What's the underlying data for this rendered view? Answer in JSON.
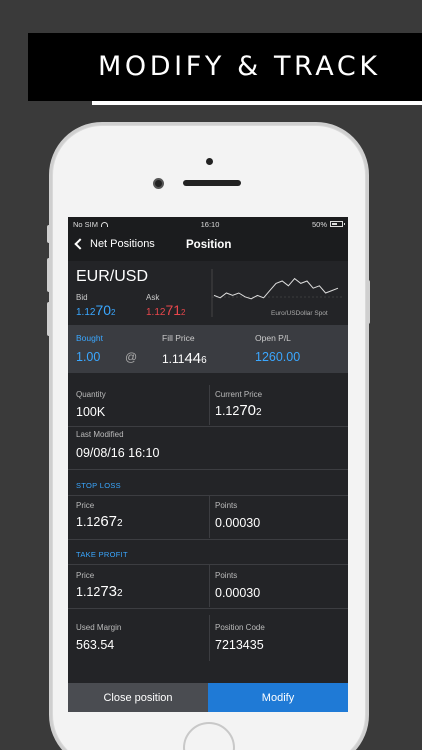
{
  "promo": {
    "headline": "MODIFY & TRACK"
  },
  "status": {
    "carrier": "No SIM",
    "time": "16:10",
    "battery": "50%"
  },
  "nav": {
    "back_label": "Net Positions",
    "title": "Position"
  },
  "instrument": {
    "symbol": "EUR/USD",
    "bid_label": "Bid",
    "ask_label": "Ask",
    "bid": {
      "pre": "1.12",
      "big": "70",
      "post": "2"
    },
    "ask": {
      "pre": "1.12",
      "big": "71",
      "post": "2"
    },
    "chart_caption": "Euro/USDollar Spot"
  },
  "fill": {
    "bought_label": "Bought",
    "bought_value": "1.00",
    "at": "@",
    "fill_price_label": "Fill Price",
    "fill_price": {
      "pre": "1.11",
      "big": "44",
      "post": "6"
    },
    "pl_label": "Open P/L",
    "pl_value": "1260.00"
  },
  "details": {
    "quantity_label": "Quantity",
    "quantity_value": "100K",
    "current_price_label": "Current Price",
    "current_price": {
      "pre": "1.12",
      "big": "70",
      "post": "2"
    },
    "last_modified_label": "Last Modified",
    "last_modified_value": "09/08/16 16:10"
  },
  "stop_loss": {
    "heading": "STOP LOSS",
    "price_label": "Price",
    "price": {
      "pre": "1.12",
      "big": "67",
      "post": "2"
    },
    "points_label": "Points",
    "points_value": "0.00030"
  },
  "take_profit": {
    "heading": "TAKE PROFIT",
    "price_label": "Price",
    "price": {
      "pre": "1.12",
      "big": "73",
      "post": "2"
    },
    "points_label": "Points",
    "points_value": "0.00030"
  },
  "margin": {
    "used_margin_label": "Used Margin",
    "used_margin_value": "563.54",
    "position_code_label": "Position Code",
    "position_code_value": "7213435"
  },
  "buttons": {
    "close_label": "Close position",
    "modify_label": "Modify"
  },
  "colors": {
    "accent": "#3aa7ff",
    "ask_red": "#e8474c",
    "modify_blue": "#1f7ad6"
  },
  "sparkline": [
    0.55,
    0.6,
    0.5,
    0.55,
    0.5,
    0.58,
    0.62,
    0.55,
    0.6,
    0.45,
    0.3,
    0.25,
    0.35,
    0.2,
    0.3,
    0.25,
    0.4,
    0.35,
    0.5,
    0.45,
    0.4
  ]
}
